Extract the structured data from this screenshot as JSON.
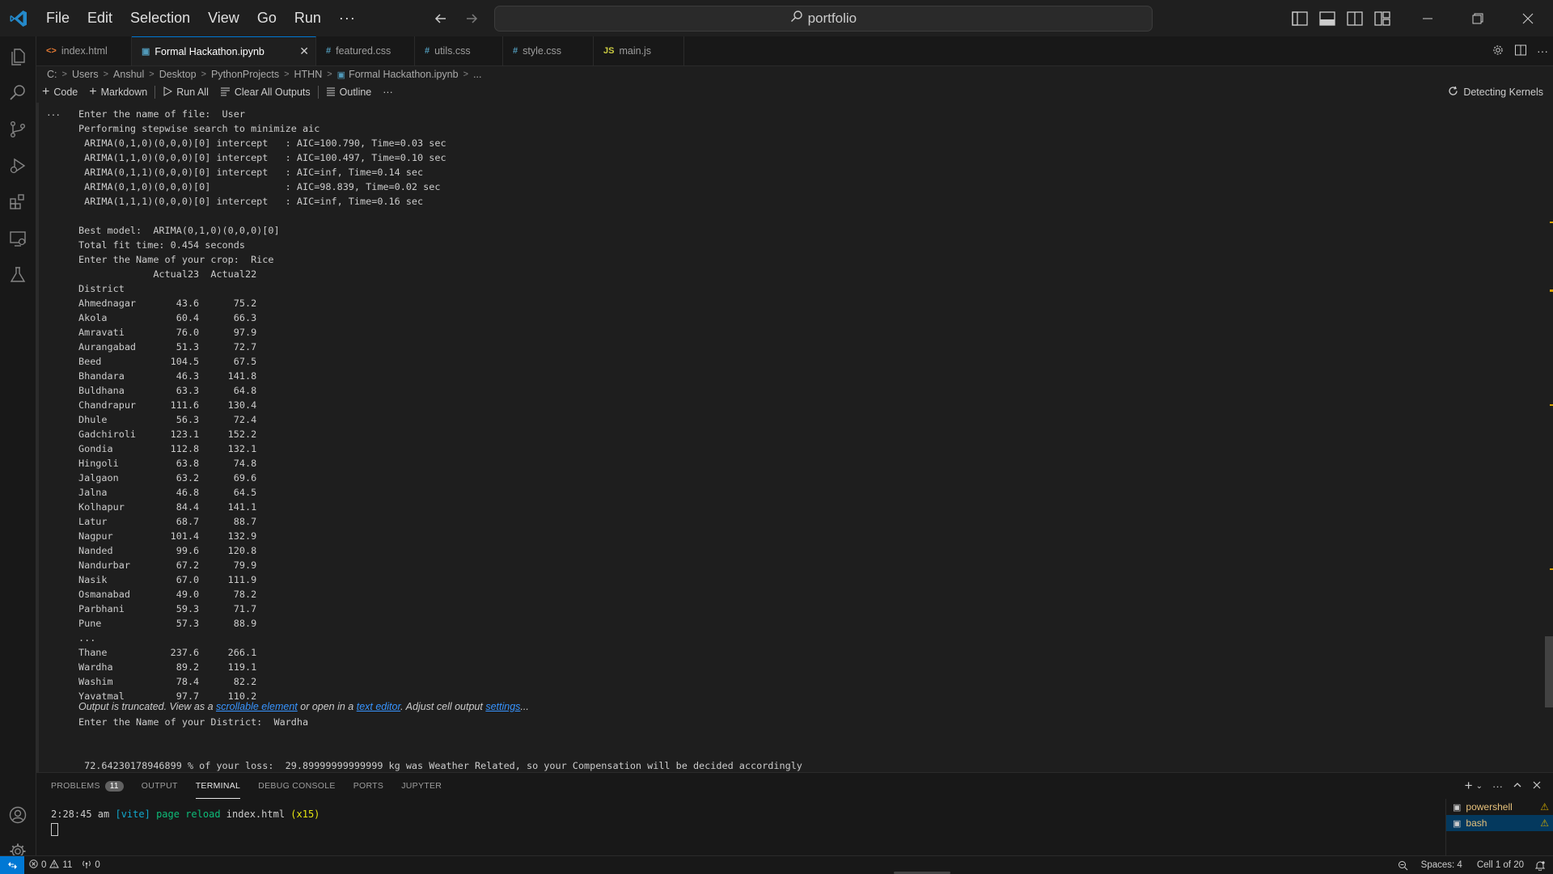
{
  "titlebar": {
    "menu": [
      "File",
      "Edit",
      "Selection",
      "View",
      "Go",
      "Run"
    ],
    "more": "···",
    "search_text": "portfolio"
  },
  "tabs": [
    {
      "icon": "<>",
      "label": "index.html",
      "icon_color": "#e37933"
    },
    {
      "icon": "▣",
      "label": "Formal Hackathon.ipynb",
      "icon_color": "#519aba",
      "close": "✕"
    },
    {
      "icon": "#",
      "label": "featured.css",
      "icon_color": "#519aba"
    },
    {
      "icon": "#",
      "label": "utils.css",
      "icon_color": "#519aba"
    },
    {
      "icon": "#",
      "label": "style.css",
      "icon_color": "#519aba"
    },
    {
      "icon": "JS",
      "label": "main.js",
      "icon_color": "#cbcb41"
    }
  ],
  "breadcrumb": [
    "C:",
    "Users",
    "Anshul",
    "Desktop",
    "PythonProjects",
    "HTHN",
    "Formal Hackathon.ipynb",
    "..."
  ],
  "toolbar": {
    "code": "Code",
    "markdown": "Markdown",
    "run_all": "Run All",
    "clear_outputs": "Clear All Outputs",
    "outline": "Outline",
    "more": "···",
    "kernel_status": "Detecting Kernels"
  },
  "output": {
    "cell_menu": "···",
    "header_lines": [
      "Enter the name of file:  User",
      "Performing stepwise search to minimize aic",
      " ARIMA(0,1,0)(0,0,0)[0] intercept   : AIC=100.790, Time=0.03 sec",
      " ARIMA(1,1,0)(0,0,0)[0] intercept   : AIC=100.497, Time=0.10 sec",
      " ARIMA(0,1,1)(0,0,0)[0] intercept   : AIC=inf, Time=0.14 sec",
      " ARIMA(0,1,0)(0,0,0)[0]             : AIC=98.839, Time=0.02 sec",
      " ARIMA(1,1,1)(0,0,0)[0] intercept   : AIC=inf, Time=0.16 sec",
      "",
      "Best model:  ARIMA(0,1,0)(0,0,0)[0]",
      "Total fit time: 0.454 seconds",
      "Enter the Name of your crop:  Rice"
    ],
    "table": {
      "columns": [
        "Actual23",
        "Actual22"
      ],
      "index_name": "District",
      "rows": [
        [
          "Ahmednagar",
          "43.6",
          "75.2"
        ],
        [
          "Akola",
          "60.4",
          "66.3"
        ],
        [
          "Amravati",
          "76.0",
          "97.9"
        ],
        [
          "Aurangabad",
          "51.3",
          "72.7"
        ],
        [
          "Beed",
          "104.5",
          "67.5"
        ],
        [
          "Bhandara",
          "46.3",
          "141.8"
        ],
        [
          "Buldhana",
          "63.3",
          "64.8"
        ],
        [
          "Chandrapur",
          "111.6",
          "130.4"
        ],
        [
          "Dhule",
          "56.3",
          "72.4"
        ],
        [
          "Gadchiroli",
          "123.1",
          "152.2"
        ],
        [
          "Gondia",
          "112.8",
          "132.1"
        ],
        [
          "Hingoli",
          "63.8",
          "74.8"
        ],
        [
          "Jalgaon",
          "63.2",
          "69.6"
        ],
        [
          "Jalna",
          "46.8",
          "64.5"
        ],
        [
          "Kolhapur",
          "84.4",
          "141.1"
        ],
        [
          "Latur",
          "68.7",
          "88.7"
        ],
        [
          "Nagpur",
          "101.4",
          "132.9"
        ],
        [
          "Nanded",
          "99.6",
          "120.8"
        ],
        [
          "Nandurbar",
          "67.2",
          "79.9"
        ],
        [
          "Nasik",
          "67.0",
          "111.9"
        ],
        [
          "Osmanabad",
          "49.0",
          "78.2"
        ],
        [
          "Parbhani",
          "59.3",
          "71.7"
        ],
        [
          "Pune",
          "57.3",
          "88.9"
        ],
        [
          "...",
          "",
          ""
        ],
        [
          "Thane",
          "237.6",
          "266.1"
        ],
        [
          "Wardha",
          "89.2",
          "119.1"
        ],
        [
          "Washim",
          "78.4",
          "82.2"
        ],
        [
          "Yavatmal",
          "97.7",
          "110.2"
        ]
      ]
    },
    "truncated": {
      "prefix": "Output is truncated. View as a ",
      "link1": "scrollable element",
      "middle": " or open in a ",
      "link2": "text editor",
      "middle2": ". Adjust cell output ",
      "link3": "settings",
      "suffix": "..."
    },
    "post_lines": [
      "Enter the Name of your District:  Wardha",
      "",
      "",
      " 72.64230178946899 % of your loss:  29.89999999999999 kg was Weather Related, so your Compensation will be decided accordingly"
    ]
  },
  "panel": {
    "tabs": [
      {
        "label": "PROBLEMS",
        "badge": "11"
      },
      {
        "label": "OUTPUT"
      },
      {
        "label": "TERMINAL",
        "active": true
      },
      {
        "label": "DEBUG CONSOLE"
      },
      {
        "label": "PORTS"
      },
      {
        "label": "JUPYTER"
      }
    ],
    "terminal": {
      "time": "2:28:45 am",
      "tag": "[vite]",
      "msg": "page reload",
      "file": "index.html",
      "count": "(x15)"
    },
    "terminals": [
      {
        "label": "powershell",
        "warn": "⚠"
      },
      {
        "label": "bash",
        "warn": "⚠",
        "active": true
      }
    ]
  },
  "statusbar": {
    "errors": "0",
    "warnings": "11",
    "ports": "0",
    "spaces": "Spaces: 4",
    "cell": "Cell 1 of 20"
  }
}
